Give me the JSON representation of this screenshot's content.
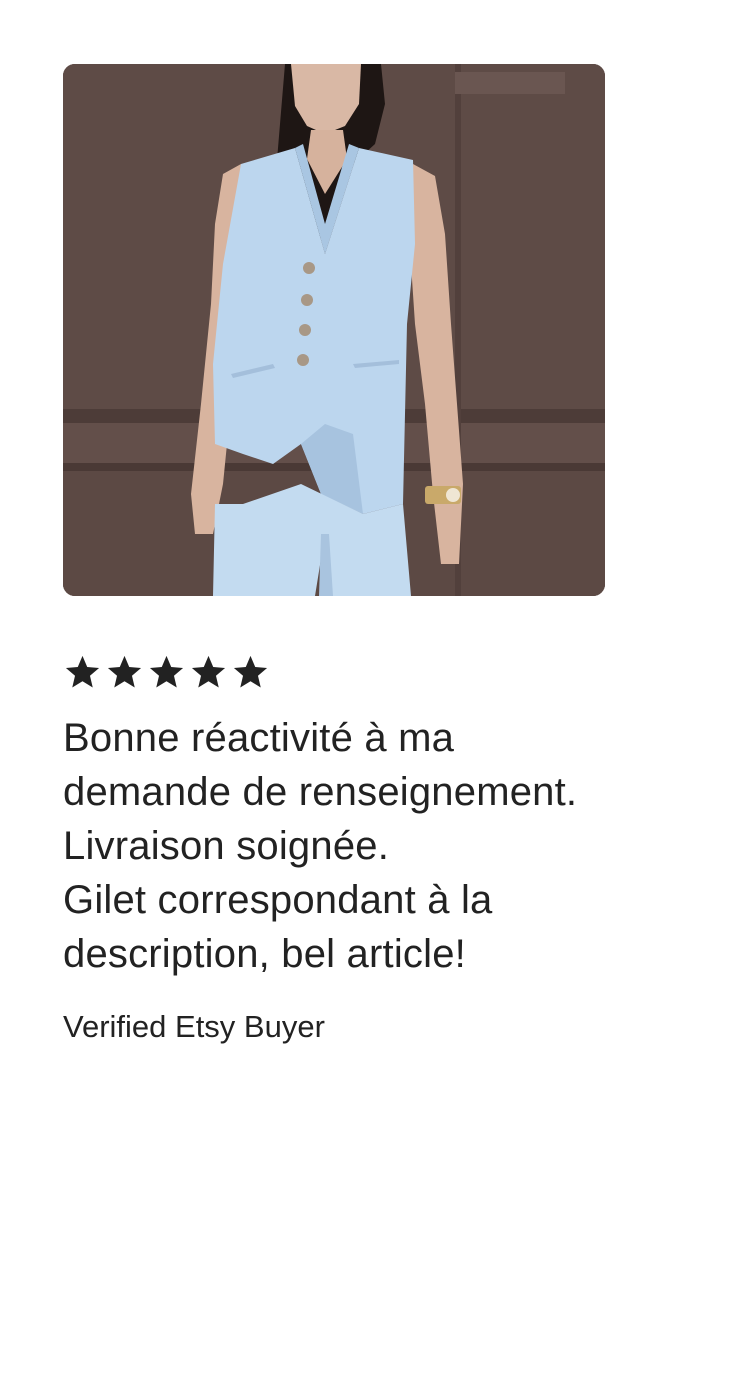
{
  "review": {
    "photo": {
      "subject": "woman-in-light-blue-linen-vest-and-trousers"
    },
    "rating": 5,
    "rating_max": 5,
    "star_color": "#222222",
    "text": "Bonne réactivité à ma\ndemande de renseignement.\nLivraison soignée.\nGilet correspondant à la\ndescription, bel article!",
    "author": "Verified Etsy Buyer"
  }
}
